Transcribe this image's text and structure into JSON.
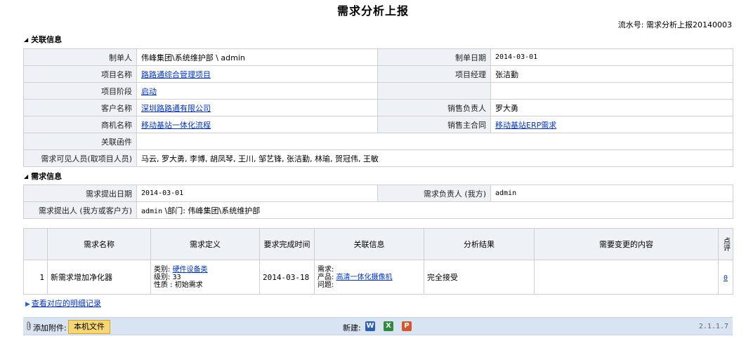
{
  "page": {
    "title": "需求分析上报",
    "serial_label": "流水号: 需求分析上报20140003"
  },
  "related_section": {
    "header": "关联信息",
    "creator_label": "制单人",
    "creator_value": "伟峰集团\\系统维护部 \\ admin",
    "date_label": "制单日期",
    "date_value": "2014-03-01",
    "project_name_label": "项目名称",
    "project_name_value": "路路通综合管理项目",
    "project_manager_label": "项目经理",
    "project_manager_value": "张洁勤",
    "project_stage_label": "项目阶段",
    "project_stage_value": "启动",
    "customer_label": "客户名称",
    "customer_value": "深圳路路通有限公司",
    "sales_owner_label": "销售负责人",
    "sales_owner_value": "罗大勇",
    "opportunity_label": "商机名称",
    "opportunity_value": "移动基站一体化流程",
    "contract_label": "销售主合同",
    "contract_value": "移动基站ERP需求",
    "related_docs_label": "关联函件",
    "related_docs_value": "",
    "visible_people_label": "需求可见人员(取项目人员)",
    "visible_people_value": "马云, 罗大勇, 李博, 胡凤琴, 王川, 邹艺锋, 张洁勤, 林瑜, 贺冠伟, 王敏"
  },
  "demand_section": {
    "header": "需求信息",
    "submit_date_label": "需求提出日期",
    "submit_date_value": "2014-03-01",
    "owner_label": "需求负责人 (我方)",
    "owner_value": "admin",
    "proposer_label": "需求提出人 (我方或客户方)",
    "proposer_value_id": "admin",
    "proposer_value_dept": " \\部门: 伟峰集团\\系统维护部"
  },
  "grid": {
    "headers": [
      "需求名称",
      "需求定义",
      "要求完成时间",
      "关联信息",
      "分析结果",
      "需要变更的内容",
      "点评"
    ],
    "rows": [
      {
        "index": "1",
        "name": "新需求增加净化器",
        "category_label": "类别:",
        "category_value": "硬件设备类",
        "level_label": "级别:",
        "level_value": "33",
        "nature_label": "性质 :",
        "nature_value": "初始需求",
        "due": "2014-03-18",
        "demand_label": "需求:",
        "product_label": "产品:",
        "product_value": "高清一体化摄像机",
        "issue_label": "问题:",
        "result": "完全接受",
        "change": "",
        "comments": "0"
      }
    ]
  },
  "footer": {
    "detail_link": "查看对应的明细记录",
    "attach_label": "添加附件:",
    "local_file_button": "本机文件",
    "new_label": "新建:",
    "version": "2.1.1.7"
  },
  "icons": {
    "clip": "paperclip-icon",
    "word": "word-doc-icon",
    "excel": "excel-doc-icon",
    "ppt": "ppt-doc-icon"
  },
  "colors": {
    "label_bg": "#eef1f6",
    "border": "#cfcfcf",
    "link": "#0033cc",
    "bar_bg": "#d8e4f2",
    "button_bg": "#f7d674"
  }
}
